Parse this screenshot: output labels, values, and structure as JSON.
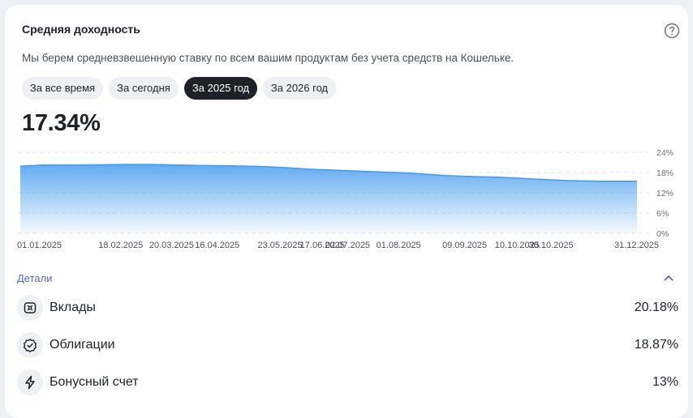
{
  "card": {
    "title": "Средняя доходность",
    "subtitle": "Мы берем средневзвешенную ставку по всем вашим продуктам без учета средств на Кошельке.",
    "help_icon": "question-circle-icon"
  },
  "tabs": [
    {
      "label": "За все время",
      "active": false
    },
    {
      "label": "За сегодня",
      "active": false
    },
    {
      "label": "За 2025 год",
      "active": true
    },
    {
      "label": "За 2026 год",
      "active": false
    }
  ],
  "big_value": "17.34%",
  "chart_data": {
    "type": "area",
    "title": "",
    "xlabel": "",
    "ylabel": "",
    "ylim": [
      0,
      24
    ],
    "y_ticks": [
      "24%",
      "18%",
      "12%",
      "6%",
      "0%"
    ],
    "y_tick_values": [
      24,
      18,
      12,
      6,
      0
    ],
    "x_tick_labels": [
      "01.01.2025",
      "18.02.2025",
      "20.03.2025",
      "16.04.2025",
      "23.05.2025",
      "17.06.2025",
      "02.07.2025",
      "01.08.2025",
      "09.09.2025",
      "10.10.2025",
      "30.10.2025",
      "31.12.2025"
    ],
    "grid": true,
    "color": "#5aa6f0",
    "series": [
      {
        "x": [
          "01.01.2025",
          "15.01.2025",
          "01.02.2025",
          "18.02.2025",
          "05.03.2025",
          "20.03.2025",
          "05.04.2025",
          "16.04.2025",
          "05.05.2025",
          "23.05.2025",
          "05.06.2025",
          "17.06.2025",
          "25.06.2025",
          "02.07.2025",
          "15.07.2025",
          "01.08.2025",
          "20.08.2025",
          "09.09.2025",
          "25.09.2025",
          "10.10.2025",
          "20.10.2025",
          "30.10.2025",
          "20.11.2025",
          "10.12.2025",
          "31.12.2025"
        ],
        "values": [
          19.9,
          20.2,
          20.2,
          20.3,
          20.4,
          20.4,
          20.2,
          20.1,
          20.0,
          19.8,
          19.5,
          19.1,
          18.9,
          18.8,
          18.5,
          18.2,
          17.8,
          17.1,
          16.8,
          16.6,
          16.4,
          16.1,
          15.6,
          15.4,
          15.4
        ]
      }
    ]
  },
  "details": {
    "label": "Детали",
    "chevron_icon": "chevron-up-icon",
    "items": [
      {
        "label": "Вклады",
        "value": "20.18%",
        "icon": "deposit-icon"
      },
      {
        "label": "Облигации",
        "value": "18.87%",
        "icon": "bond-badge-icon"
      },
      {
        "label": "Бонусный счет",
        "value": "13%",
        "icon": "lightning-icon"
      }
    ]
  }
}
